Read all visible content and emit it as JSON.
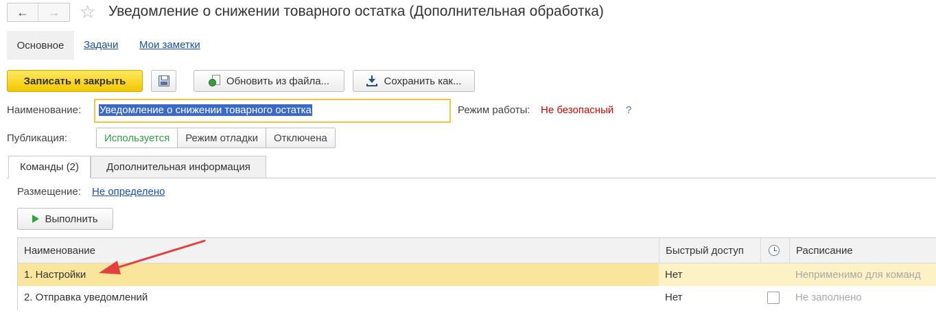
{
  "header": {
    "back_icon": "←",
    "forward_icon": "→",
    "favorite_icon": "☆",
    "title": "Уведомление о снижении товарного остатка (Дополнительная обработка)"
  },
  "sections": {
    "main": "Основное",
    "tasks": "Задачи",
    "notes": "Мои заметки"
  },
  "toolbar": {
    "save_close": "Записать и закрыть",
    "update_from_file": "Обновить из файла...",
    "save_as": "Сохранить как..."
  },
  "form": {
    "name_label": "Наименование:",
    "name_value": "Уведомление о снижении товарного остатка",
    "mode_label": "Режим работы:",
    "mode_value": "Не безопасный",
    "mode_help": "?",
    "publication_label": "Публикация:",
    "publication_options": [
      "Используется",
      "Режим отладки",
      "Отключена"
    ],
    "publication_selected": "Используется"
  },
  "tabs": {
    "commands": "Команды (2)",
    "additional": "Дополнительная информация"
  },
  "placement": {
    "label": "Размещение:",
    "value": "Не определено"
  },
  "commands": {
    "run_label": "Выполнить",
    "columns": {
      "name": "Наименование",
      "quick_access": "Быстрый доступ",
      "schedule": "Расписание"
    },
    "rows": [
      {
        "name": "1. Настройки",
        "quick_access": "Нет",
        "schedule": "Неприменимо для команд"
      },
      {
        "name": "2. Отправка уведомлений",
        "quick_access": "Нет",
        "schedule": "Не заполнено"
      }
    ]
  },
  "colors": {
    "primary_button": "#f3c800",
    "selected_row": "#fae59c",
    "link": "#1a4eaa",
    "warning": "#e00000",
    "active_option": "#2e9c47",
    "annotation_arrow": "#e2403a"
  }
}
